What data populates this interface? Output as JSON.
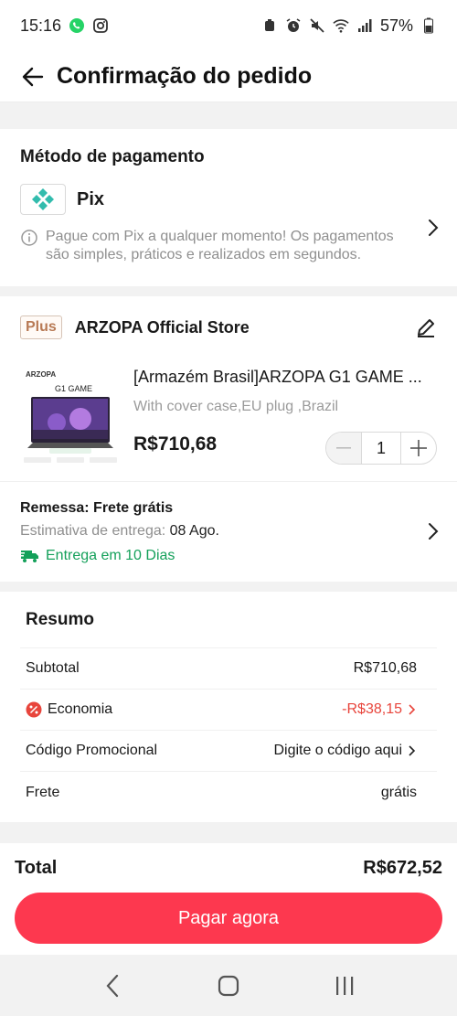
{
  "status_bar": {
    "time": "15:16",
    "battery": "57%",
    "icons": [
      "whatsapp-icon",
      "instagram-icon",
      "alarm-icon",
      "mute-icon",
      "wifi-icon",
      "signal-icon",
      "battery-icon"
    ]
  },
  "header": {
    "title": "Confirmação do pedido"
  },
  "payment": {
    "section_title": "Método de pagamento",
    "method_name": "Pix",
    "info_text": "Pague com Pix a qualquer momento! Os pagamentos são simples, práticos e realizados em segundos."
  },
  "store": {
    "badge": "Plus",
    "name": "ARZOPA Official Store"
  },
  "product": {
    "title": "[Armazém Brasil]ARZOPA G1 GAME ...",
    "variant": "With cover case,EU plug ,Brazil",
    "price": "R$710,68",
    "quantity": "1",
    "image_brand": "ARZOPA",
    "image_model": "G1 GAME"
  },
  "shipping": {
    "title": "Remessa: Frete grátis",
    "estimate_label": "Estimativa de entrega:",
    "estimate_date": "08 Ago.",
    "delivery_note": "Entrega em 10 Dias"
  },
  "summary": {
    "title": "Resumo",
    "subtotal_label": "Subtotal",
    "subtotal_value": "R$710,68",
    "savings_label": "Economia",
    "savings_value": "-R$38,15",
    "promo_label": "Código Promocional",
    "promo_value": "Digite o código aqui",
    "shipping_label": "Frete",
    "shipping_value": "grátis"
  },
  "checkout": {
    "total_label": "Total",
    "total_value": "R$672,52",
    "pay_button": "Pagar agora"
  },
  "colors": {
    "accent": "#fd384f",
    "green": "#14a05a",
    "discount_red": "#e8453c",
    "pix_teal": "#32bcad"
  }
}
